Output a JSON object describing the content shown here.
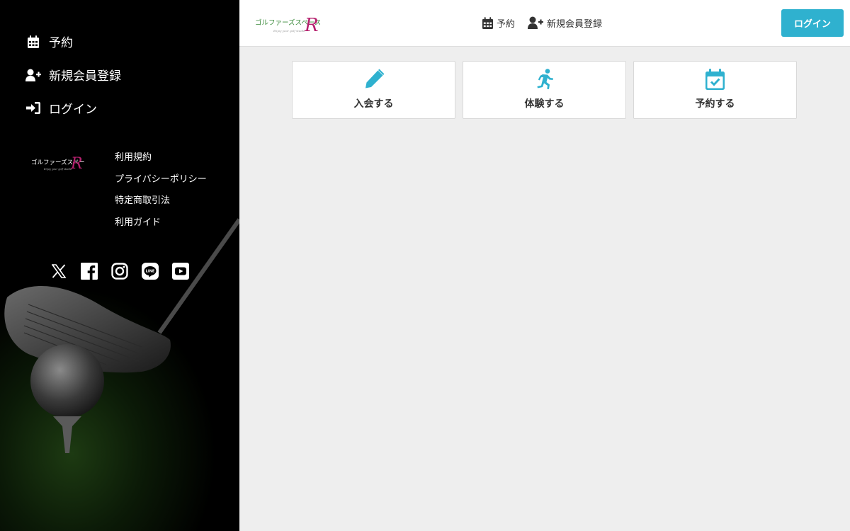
{
  "sidebar": {
    "nav": [
      {
        "label": "予約",
        "icon": "calendar-icon"
      },
      {
        "label": "新規会員登録",
        "icon": "user-plus-icon"
      },
      {
        "label": "ログイン",
        "icon": "sign-in-icon"
      }
    ],
    "logo_text": "ゴルファーズスペース",
    "logo_mark": "R",
    "logo_tagline": "Enjoy your golf studio",
    "links": [
      "利用規約",
      "プライバシーポリシー",
      "特定商取引法",
      "利用ガイド"
    ],
    "social": [
      "x-icon",
      "facebook-icon",
      "instagram-icon",
      "line-icon",
      "youtube-icon"
    ]
  },
  "header": {
    "logo_text": "ゴルファーズスペース",
    "logo_mark": "R",
    "logo_tagline": "Enjoy your golf studio",
    "nav": [
      {
        "label": "予約",
        "icon": "calendar-icon"
      },
      {
        "label": "新規会員登録",
        "icon": "user-plus-icon"
      }
    ],
    "login_label": "ログイン"
  },
  "cards": [
    {
      "label": "入会する",
      "icon": "pencil-icon"
    },
    {
      "label": "体験する",
      "icon": "running-person-icon"
    },
    {
      "label": "予約する",
      "icon": "calendar-check-icon"
    }
  ],
  "colors": {
    "accent": "#2fb1cf",
    "logo_green": "#3a8a3a",
    "logo_magenta": "#b5216e"
  }
}
